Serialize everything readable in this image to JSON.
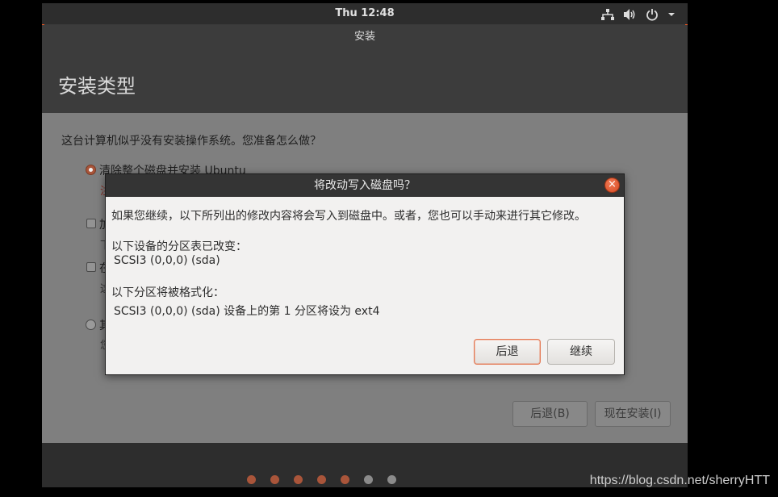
{
  "topbar": {
    "clock": "Thu 12:48",
    "tray_icons": [
      "network-icon",
      "volume-icon",
      "power-icon",
      "chevron-down-icon"
    ]
  },
  "window": {
    "title": "安装"
  },
  "page": {
    "heading": "安装类型",
    "question": "这台计算机似乎没有安装操作系统。您准备怎么做？",
    "option_erase_label": "清除整个磁盘并安装 Ubuntu",
    "option_erase_sub": "注",
    "option_a_label": "加",
    "option_a_sub": "下",
    "option_b_label": "在",
    "option_b_sub": "这",
    "option_c_label": "其",
    "option_c_sub": "您",
    "back_button": "后退(B)",
    "install_button": "现在安装(I)"
  },
  "progress": {
    "total_steps": 7,
    "completed_steps": 5
  },
  "dialog": {
    "title": "将改动写入磁盘吗？",
    "close_label": "×",
    "intro": "如果您继续，以下所列出的修改内容将会写入到磁盘中。或者，您也可以手动来进行其它修改。",
    "partition_table_header": "以下设备的分区表已改变：",
    "partition_table_device": "SCSI3 (0,0,0) (sda)",
    "format_header": "以下分区将被格式化：",
    "format_detail": "SCSI3 (0,0,0) (sda) 设备上的第 1 分区将设为 ext4",
    "back_button": "后退",
    "continue_button": "继续"
  },
  "watermark": "https://blog.csdn.net/sherryHTT",
  "colors": {
    "accent": "#e95420",
    "progress_done": "#a9553a",
    "progress_todo": "#8b8b8b"
  }
}
